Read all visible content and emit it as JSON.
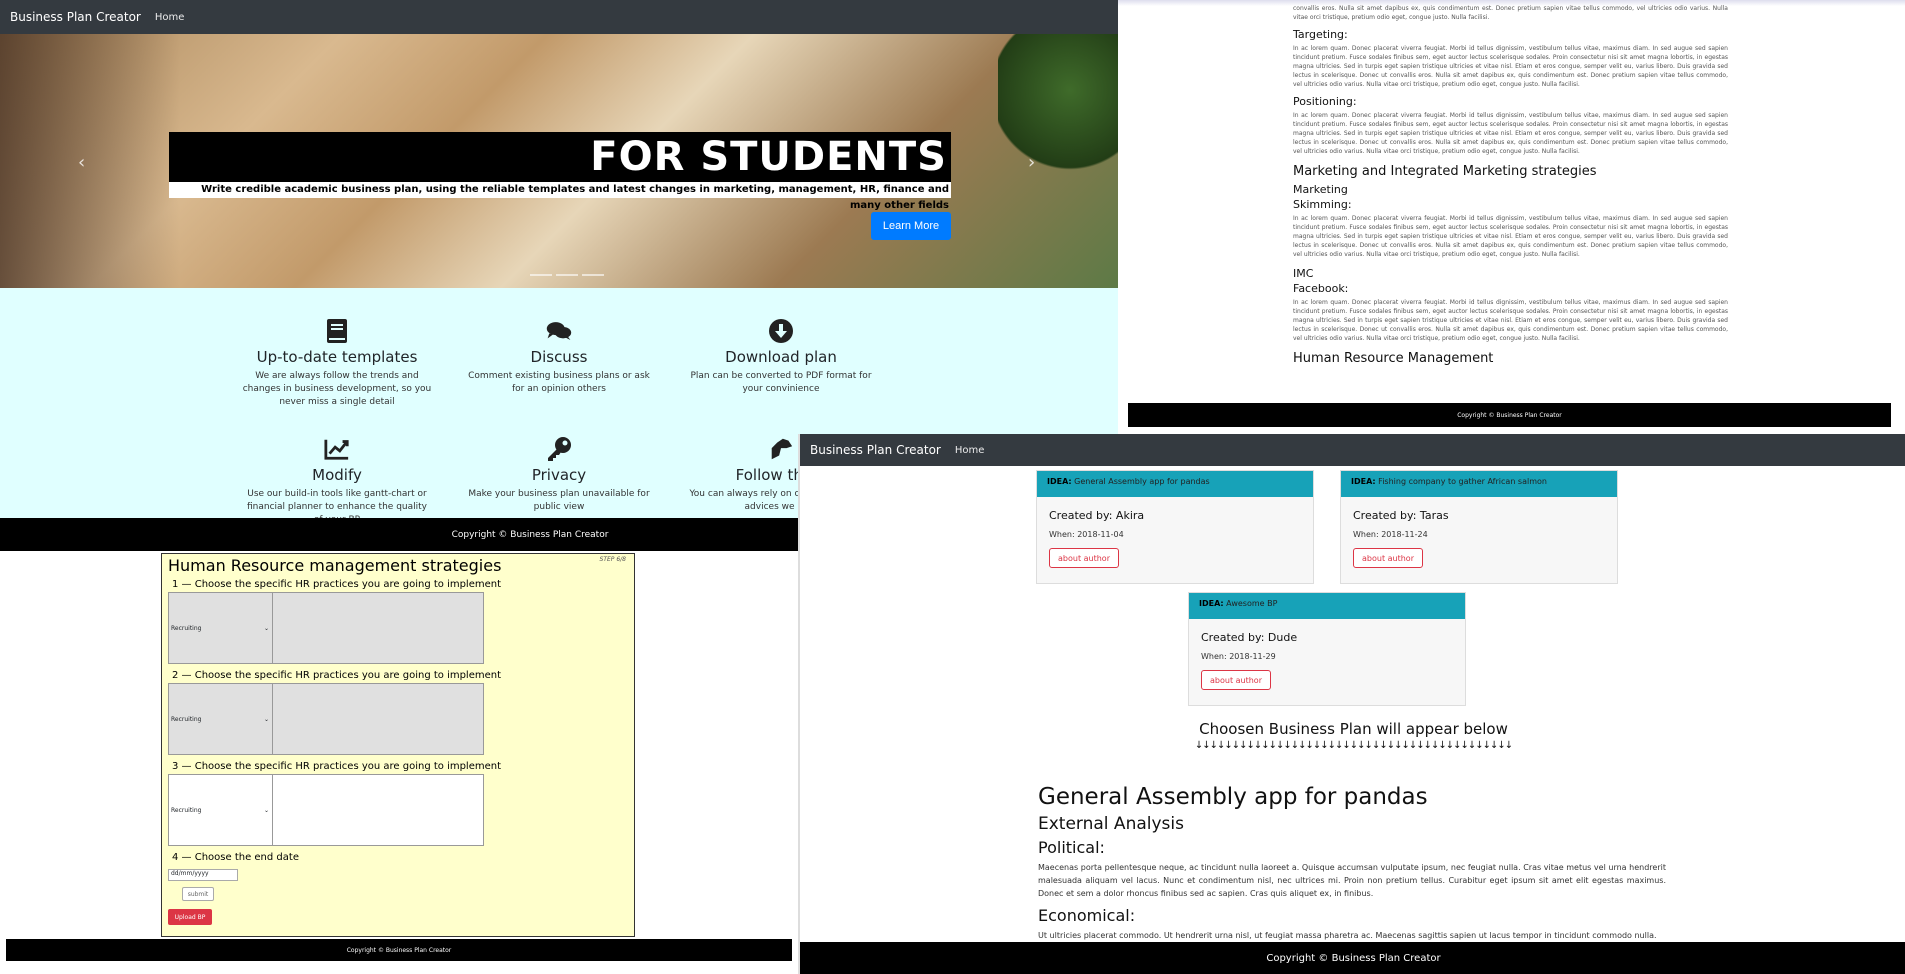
{
  "panel_a": {
    "navbar": {
      "brand": "Business Plan Creator",
      "home": "Home"
    },
    "hero": {
      "headline": "FOR STUDENTS",
      "subtitle": "Write credible academic business plan, using the reliable templates and latest changes in marketing, management, HR, finance and many other fields",
      "button": "Learn More",
      "prev_icon": "chevron-left-icon",
      "next_icon": "chevron-right-icon"
    },
    "features": [
      {
        "icon": "book-icon",
        "title": "Up-to-date templates",
        "desc": "We are always follow the trends and changes in business development, so you never miss a single detail"
      },
      {
        "icon": "comments-icon",
        "title": "Discuss",
        "desc": "Comment existing business plans or ask for an opinion others"
      },
      {
        "icon": "download-icon",
        "title": "Download plan",
        "desc": "Plan can be converted to PDF format for your convinience"
      },
      {
        "icon": "chart-line-icon",
        "title": "Modify",
        "desc": "Use our build-in tools like gantt-chart or financial planner to enhance the quality of your BP"
      },
      {
        "icon": "key-icon",
        "title": "Privacy",
        "desc": "Make your business plan unavailable for public view"
      },
      {
        "icon": "hand-icon",
        "title": "Follow the g",
        "desc": "You can always rely on our t the tips and advices we prov"
      }
    ],
    "footer": "Copyright © Business Plan Creator"
  },
  "panel_b": {
    "sections": [
      {
        "kind": "para",
        "text": "convallis eros. Nulla sit amet dapibus ex, quis condimentum est. Donec pretium sapien vitae tellus commodo, vel ultricies odio varius. Nulla vitae orci tristique, pretium odio eget, congue justo. Nulla facilisi."
      },
      {
        "kind": "h4",
        "text": "Targeting:"
      },
      {
        "kind": "para",
        "text": "In ac lorem quam. Donec placerat viverra feugiat. Morbi id tellus dignissim, vestibulum tellus vitae, maximus diam. In sed augue sed sapien tincidunt pretium. Fusce sodales finibus sem, eget auctor lectus scelerisque sodales. Proin consectetur nisi sit amet magna lobortis, in egestas magna ultricies. Sed in turpis eget sapien tristique ultricies et vitae nisl. Etiam et eros congue, semper velit eu, varius libero. Duis gravida sed lectus in scelerisque. Donec ut convallis eros. Nulla sit amet dapibus ex, quis condimentum est. Donec pretium sapien vitae tellus commodo, vel ultricies odio varius. Nulla vitae orci tristique, pretium odio eget, congue justo. Nulla facilisi."
      },
      {
        "kind": "h4",
        "text": "Positioning:"
      },
      {
        "kind": "para",
        "text": "In ac lorem quam. Donec placerat viverra feugiat. Morbi id tellus dignissim, vestibulum tellus vitae, maximus diam. In sed augue sed sapien tincidunt pretium. Fusce sodales finibus sem, eget auctor lectus scelerisque sodales. Proin consectetur nisi sit amet magna lobortis, in egestas magna ultricies. Sed in turpis eget sapien tristique ultricies et vitae nisl. Etiam et eros congue, semper velit eu, varius libero. Duis gravida sed lectus in scelerisque. Donec ut convallis eros. Nulla sit amet dapibus ex, quis condimentum est. Donec pretium sapien vitae tellus commodo, vel ultricies odio varius. Nulla vitae orci tristique, pretium odio eget, congue justo. Nulla facilisi."
      },
      {
        "kind": "h3",
        "text": "Marketing and Integrated Marketing strategies"
      },
      {
        "kind": "h4",
        "text": "Marketing"
      },
      {
        "kind": "h4",
        "text": "Skimming:"
      },
      {
        "kind": "para",
        "text": "In ac lorem quam. Donec placerat viverra feugiat. Morbi id tellus dignissim, vestibulum tellus vitae, maximus diam. In sed augue sed sapien tincidunt pretium. Fusce sodales finibus sem, eget auctor lectus scelerisque sodales. Proin consectetur nisi sit amet magna lobortis, in egestas magna ultricies. Sed in turpis eget sapien tristique ultricies et vitae nisl. Etiam et eros congue, semper velit eu, varius libero. Duis gravida sed lectus in scelerisque. Donec ut convallis eros. Nulla sit amet dapibus ex, quis condimentum est. Donec pretium sapien vitae tellus commodo, vel ultricies odio varius. Nulla vitae orci tristique, pretium odio eget, congue justo. Nulla facilisi."
      },
      {
        "kind": "h4",
        "text": "IMC"
      },
      {
        "kind": "h4",
        "text": "Facebook:"
      },
      {
        "kind": "para",
        "text": "In ac lorem quam. Donec placerat viverra feugiat. Morbi id tellus dignissim, vestibulum tellus vitae, maximus diam. In sed augue sed sapien tincidunt pretium. Fusce sodales finibus sem, eget auctor lectus scelerisque sodales. Proin consectetur nisi sit amet magna lobortis, in egestas magna ultricies. Sed in turpis eget sapien tristique ultricies et vitae nisl. Etiam et eros congue, semper velit eu, varius libero. Duis gravida sed lectus in scelerisque. Donec ut convallis eros. Nulla sit amet dapibus ex, quis condimentum est. Donec pretium sapien vitae tellus commodo, vel ultricies odio varius. Nulla vitae orci tristique, pretium odio eget, congue justo. Nulla facilisi."
      },
      {
        "kind": "h3",
        "text": "Human Resource Management"
      }
    ],
    "footer": "Copyright © Business Plan Creator"
  },
  "panel_c": {
    "title": "Human Resource management strategies",
    "step": "STEP 6/8",
    "q1": "1 — Choose the specific HR practices you are going to implement",
    "q2": "2 — Choose the specific HR practices you are going to implement",
    "q3": "3 — Choose the specific HR practices you are going to implement",
    "q4": "4 — Choose the end date",
    "select_value": "Recruiting",
    "date_placeholder": "dd/mm/yyyy",
    "submit": "submit",
    "upload": "Upload BP",
    "footer": "Copyright © Business Plan Creator"
  },
  "panel_d": {
    "navbar": {
      "brand": "Business Plan Creator",
      "home": "Home"
    },
    "ideas": [
      {
        "label": "IDEA:",
        "name": "General Assembly app for pandas",
        "by": "Created by: Akira",
        "when": "When: 2018-11-04",
        "btn": "about author"
      },
      {
        "label": "IDEA:",
        "name": "Fishing company to gather African salmon",
        "by": "Created by: Taras",
        "when": "When: 2018-11-24",
        "btn": "about author"
      },
      {
        "label": "IDEA:",
        "name": "Awesome BP",
        "by": "Created by: Dude",
        "when": "When: 2018-11-29",
        "btn": "about author"
      }
    ],
    "choose_text": "Choosen Business Plan will appear below",
    "arrows": "↓↓↓↓↓↓↓↓↓↓↓↓↓↓↓↓↓↓↓↓↓↓↓↓↓↓↓↓↓↓↓↓↓↓↓↓↓↓↓↓↓↓↓",
    "bp_title": "General Assembly app for pandas",
    "bp_section": "External Analysis",
    "bp_political": "Political:",
    "bp_political_text": "Maecenas porta pellentesque neque, ac tincidunt nulla laoreet a. Quisque accumsan vulputate ipsum, nec feugiat nulla. Cras vitae metus vel urna hendrerit malesuada aliquam vel lacus. Nunc et condimentum nisl, nec ultrices mi. Proin non pretium tellus. Curabitur eget ipsum sit amet elit egestas maximus. Donec et sem a dolor rhoncus finibus sed ac sapien. Cras quis aliquet ex, in finibus.",
    "bp_economical": "Economical:",
    "bp_economical_text": "Ut ultricies placerat commodo. Ut hendrerit urna nisl, ut feugiat massa pharetra ac. Maecenas sagittis sapien ut lacus tempor in tincidunt commodo nulla.",
    "footer": "Copyright © Business Plan Creator"
  }
}
